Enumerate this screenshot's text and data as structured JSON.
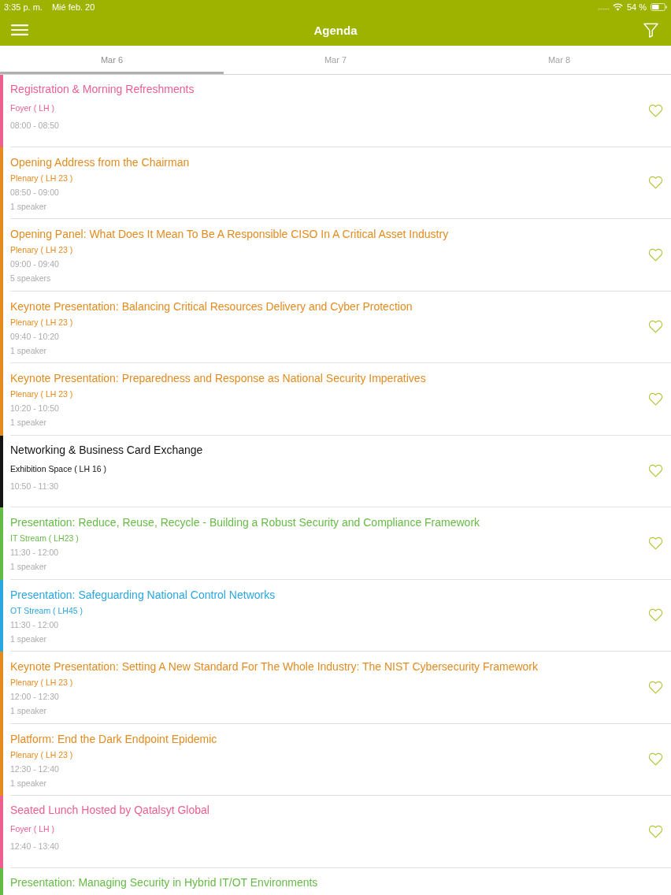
{
  "status_bar": {
    "time": "3:35 p. m.",
    "date": "Mié feb. 20",
    "battery": "54 %"
  },
  "header": {
    "title": "Agenda"
  },
  "tabs": [
    {
      "label": "Mar 6",
      "selected": true
    },
    {
      "label": "Mar 7",
      "selected": false
    },
    {
      "label": "Mar 8",
      "selected": false
    }
  ],
  "sessions": [
    {
      "title": "Registration & Morning Refreshments",
      "color": "#ec5f8e",
      "location": "Foyer ( LH )",
      "time": "08:00 - 08:50",
      "favorite": false
    },
    {
      "title": "Opening Address from the Chairman",
      "color": "#e38b1f",
      "location": "Plenary ( LH 23 )",
      "time": "08:50 - 09:00",
      "speakers": "1 speaker",
      "favorite": false
    },
    {
      "title": "Opening Panel: What Does It Mean To Be A Responsible CISO In A Critical Asset Industry",
      "color": "#e38b1f",
      "location": "Plenary ( LH 23 )",
      "time": "09:00 - 09:40",
      "speakers": "5 speakers",
      "favorite": false
    },
    {
      "title": "Keynote Presentation: Balancing Critical Resources Delivery and Cyber Protection",
      "color": "#e38b1f",
      "location": "Plenary ( LH 23 )",
      "time": "09:40 - 10:20",
      "speakers": "1 speaker",
      "favorite": false
    },
    {
      "title": "Keynote Presentation: Preparedness and Response as National Security Imperatives",
      "color": "#e38b1f",
      "location": "Plenary ( LH 23 )",
      "time": "10:20 - 10:50",
      "speakers": "1 speaker",
      "favorite": false
    },
    {
      "title": "Networking & Business Card Exchange",
      "color": "#141414",
      "location": "Exhibition Space ( LH 16 )",
      "time": "10:50 - 11:30",
      "favorite": false
    },
    {
      "title": "Presentation: Reduce, Reuse, Recycle - Building a Robust Security and Compliance Framework",
      "color": "#66bb46",
      "location": "IT Stream ( LH23 )",
      "time": "11:30 - 12:00",
      "speakers": "1 speaker",
      "favorite": false
    },
    {
      "title": "Presentation: Safeguarding National Control Networks",
      "color": "#2ba6de",
      "location": "OT Stream ( LH45 )",
      "time": "11:30 - 12:00",
      "speakers": "1 speaker",
      "favorite": false
    },
    {
      "title": "Keynote Presentation: Setting A New Standard For The Whole Industry: The NIST Cybersecurity Framework",
      "color": "#e38b1f",
      "location": "Plenary ( LH 23 )",
      "time": "12:00 - 12:30",
      "speakers": "1 speaker",
      "favorite": false
    },
    {
      "title": "Platform: End the Dark Endpoint Epidemic",
      "color": "#e38b1f",
      "location": "Plenary ( LH 23 )",
      "time": "12:30 - 12:40",
      "speakers": "1 speaker",
      "favorite": false
    },
    {
      "title": "Seated Lunch Hosted by Qatalsyt Global",
      "color": "#ec5f8e",
      "location": "Foyer ( LH )",
      "time": "12:40 - 13:40",
      "favorite": false
    },
    {
      "title": "Presentation: Managing Security in Hybrid IT/OT Environments",
      "color": "#66bb46"
    }
  ]
}
